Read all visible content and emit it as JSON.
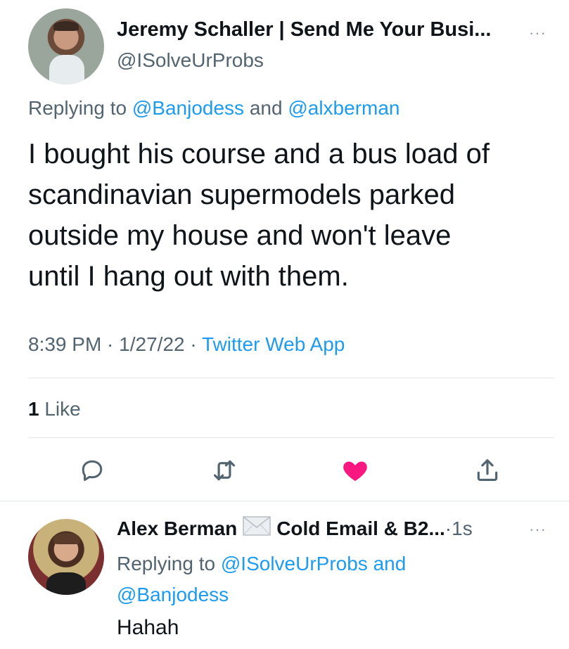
{
  "main_tweet": {
    "author_name": "Jeremy Schaller | Send Me Your Busi...",
    "author_handle": "@ISolveUrProbs",
    "replying_prefix": "Replying to ",
    "replying_user1": "@Banjodess",
    "replying_and": " and ",
    "replying_user2": "@alxberman",
    "text_lines": [
      "I bought his course and a bus load of",
      "scandinavian supermodels parked",
      "outside my house and won't leave",
      "until I hang out with them."
    ],
    "time": "8:39 PM",
    "sep1": " · ",
    "date": "1/27/22",
    "sep2": " · ",
    "source": "Twitter Web App",
    "likes_count": "1",
    "likes_label": " Like",
    "more_glyph": "···"
  },
  "actions": {
    "reply_icon": "reply-icon",
    "retweet_icon": "retweet-icon",
    "like_icon": "heart-icon",
    "share_icon": "share-icon",
    "liked_color": "#f91880",
    "icon_color": "#536471"
  },
  "reply_tweet": {
    "author_name": "Alex Berman",
    "author_suffix": "Cold Email & B2...",
    "time_sep": " · ",
    "time": "1s",
    "replying_prefix": "Replying to ",
    "replying_user1": "@ISolveUrProbs",
    "replying_and": " and",
    "replying_user2": "@Banjodess",
    "text": "Hahah",
    "more_glyph": "···"
  }
}
